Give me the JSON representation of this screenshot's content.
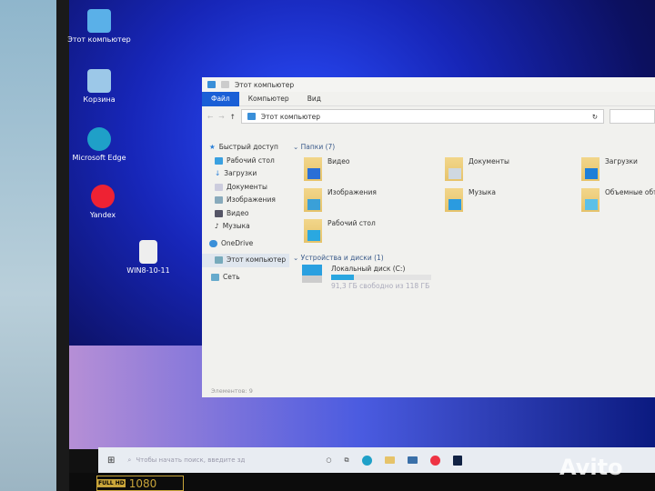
{
  "desktop": {
    "icons": [
      {
        "label": "Этот компьютер"
      },
      {
        "label": "Корзина"
      },
      {
        "label": "Microsoft Edge"
      },
      {
        "label": "Yandex"
      },
      {
        "label": "WIN8-10-11"
      }
    ]
  },
  "explorer": {
    "title": "Этот компьютер",
    "ribbon": [
      "Файл",
      "Компьютер",
      "Вид"
    ],
    "address": "Этот компьютер",
    "sidebar": [
      "Быстрый доступ",
      "Рабочий стол",
      "Загрузки",
      "Документы",
      "Изображения",
      "Видео",
      "Музыка",
      "OneDrive",
      "Этот компьютер",
      "Сеть"
    ],
    "folders_header": "Папки (7)",
    "folders": [
      {
        "name": "Видео",
        "color": "#2a6fd6"
      },
      {
        "name": "Документы",
        "color": "#cfd8e0"
      },
      {
        "name": "Загрузки",
        "color": "#1e7fd8"
      },
      {
        "name": "Изображения",
        "color": "#3aa0d8"
      },
      {
        "name": "Музыка",
        "color": "#2a9be0"
      },
      {
        "name": "Объемные объекты",
        "color": "#5cc0e8"
      },
      {
        "name": "Рабочий стол",
        "color": "#2aa8e0"
      }
    ],
    "devices_header": "Устройства и диски (1)",
    "drive": {
      "name": "Локальный диск (C:)",
      "free": "91,3 ГБ свободно из 118 ГБ",
      "used_percent": 23
    },
    "status": "Элементов: 9"
  },
  "taskbar": {
    "search_placeholder": "Чтобы начать поиск, введите зд"
  },
  "bezel": {
    "sticker_top": "FULL HD",
    "sticker_num": "1080",
    "watermark": "Avito"
  }
}
